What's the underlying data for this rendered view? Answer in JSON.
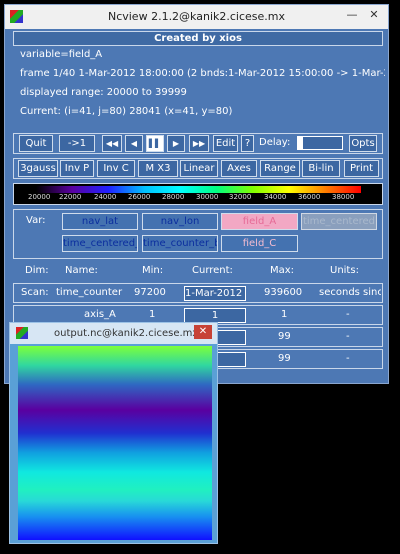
{
  "main_window": {
    "title": "Ncview 2.1.2@kanik2.cicese.mx",
    "created_by": "Created by xios",
    "variable_line": "variable=field_A",
    "frame_line": "frame 1/40 1-Mar-2012 18:00:00 (2 bnds:1-Mar-2012 15:00:00 -> 1-Mar-2012 21:00",
    "range_line": "displayed range: 20000 to 39999",
    "current_line": "Current: (i=41, j=80) 28041 (x=41, y=80)"
  },
  "window_controls": {
    "minimize": "—",
    "maximize": "☐",
    "close": "✕"
  },
  "toolbar1": {
    "quit": "Quit",
    "step": "->1",
    "fast_back": "◀◀",
    "back": "◀",
    "pause": "▌▌",
    "forward": "▶",
    "fast_forward": "▶▶",
    "edit": "Edit",
    "help": "?",
    "delay_label": "Delay:",
    "opts": "Opts"
  },
  "toolbar2": [
    "3gauss",
    "Inv P",
    "Inv C",
    "M X3",
    "Linear",
    "Axes",
    "Range",
    "Bi-lin",
    "Print"
  ],
  "colorbar": {
    "ticks": [
      "20000",
      "22000",
      "24000",
      "26000",
      "28000",
      "30000",
      "32000",
      "34000",
      "36000",
      "38000"
    ],
    "colors": [
      "#000000",
      "#5a00a0",
      "#2020ff",
      "#00c0ff",
      "#00ffff",
      "#00ff80",
      "#80ff00",
      "#ffff00",
      "#ff8000",
      "#ff0000"
    ]
  },
  "variables": {
    "label": "Var:",
    "items": [
      "nav_lat",
      "nav_lon",
      "field_A",
      "time_centered",
      "time_centered_b",
      "time_counter_b",
      "field_C"
    ]
  },
  "dims": {
    "headers": [
      "Dim:",
      "Name:",
      "Min:",
      "Current:",
      "Max:",
      "Units:"
    ],
    "rows": [
      {
        "dim": "Scan:",
        "name": "time_counter",
        "min": "97200",
        "current": "1-Mar-2012 2",
        "max": "939600",
        "units": "seconds sinc"
      },
      {
        "dim": "",
        "name": "axis_A",
        "min": "1",
        "current": "1",
        "max": "1",
        "units": "-"
      },
      {
        "dim": "",
        "name": "",
        "min": "",
        "current": "",
        "max": "99",
        "units": "-"
      },
      {
        "dim": "",
        "name": "",
        "min": "",
        "current": "",
        "max": "99",
        "units": "-"
      }
    ]
  },
  "output_window": {
    "title": "output.nc@kanik2.cicese.mx",
    "close": "✕"
  }
}
